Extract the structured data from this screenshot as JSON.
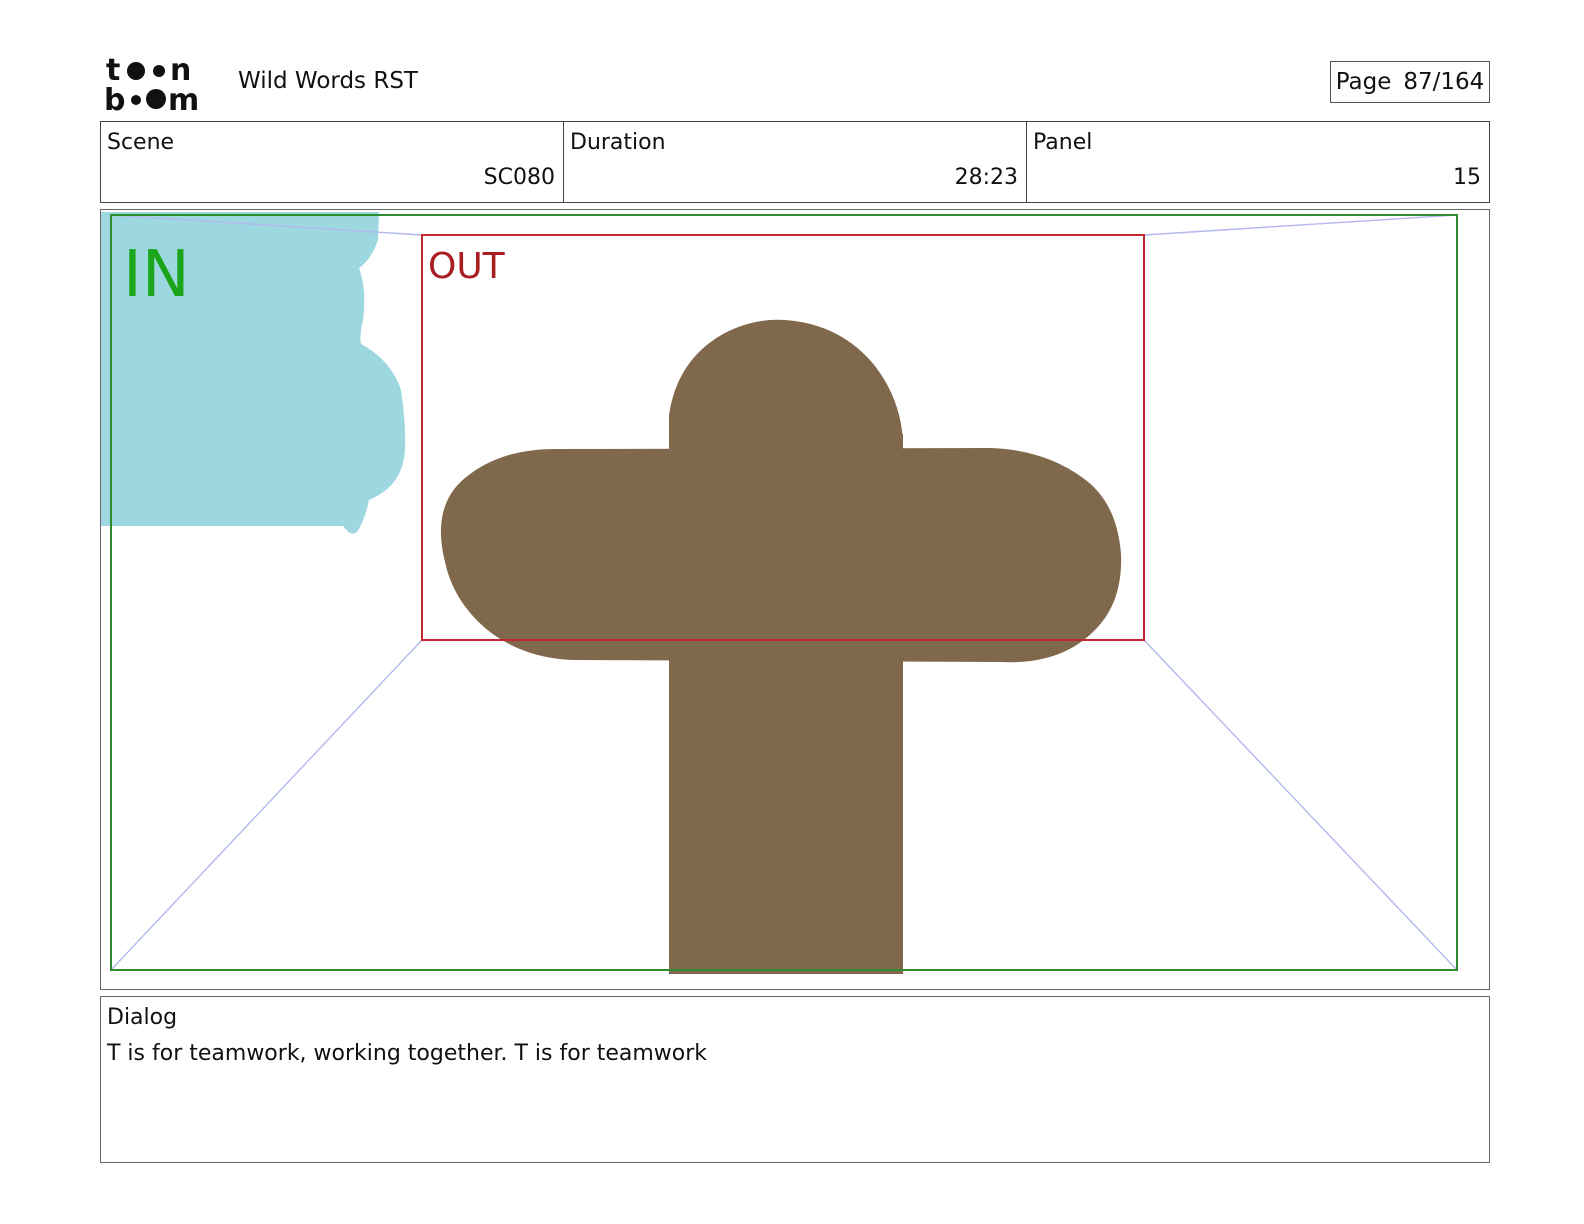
{
  "header": {
    "logo_alt": "toon boom",
    "project_title": "Wild Words RST",
    "page_label": "Page",
    "page_number": "87/164"
  },
  "info": {
    "scene_label": "Scene",
    "scene_value": "SC080",
    "duration_label": "Duration",
    "duration_value": "28:23",
    "panel_label": "Panel",
    "panel_value": "15"
  },
  "panel": {
    "in_label": "IN",
    "out_label": "OUT",
    "colors": {
      "in_frame": "#2e8b2e",
      "in_text": "#1aa51a",
      "out_frame": "#c0282d",
      "out_text": "#a81e22",
      "camera_lines": "#b3b8ee",
      "cloud": "#9dd7e0",
      "tree": "#7f684b"
    }
  },
  "dialog": {
    "label": "Dialog",
    "text": "T is for teamwork, working together. T is for teamwork"
  }
}
